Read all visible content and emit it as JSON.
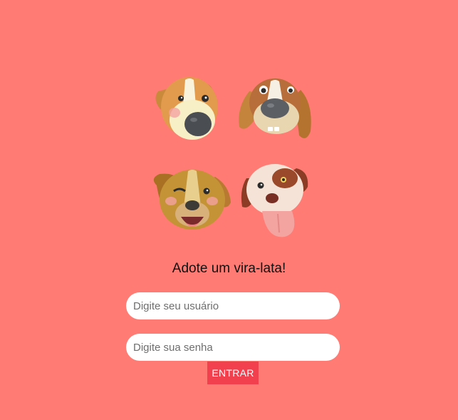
{
  "page": {
    "title": "Adote um vira-lata!"
  },
  "login": {
    "username_placeholder": "Digite seu usuário",
    "username_value": "",
    "password_placeholder": "Digite sua senha",
    "password_value": "",
    "submit_label": "ENTRAR"
  },
  "illustration": {
    "icon": "dogs-illustration",
    "dogs": [
      "dog-1-icon",
      "dog-2-icon",
      "dog-3-icon",
      "dog-4-icon"
    ]
  },
  "colors": {
    "background": "#ff7b73",
    "button": "#f3404f",
    "input": "#ffffff"
  }
}
